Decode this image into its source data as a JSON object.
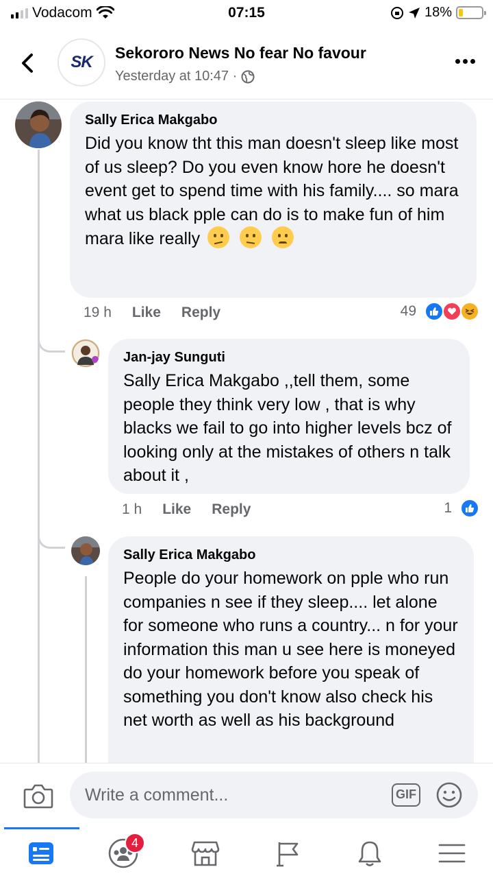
{
  "status_bar": {
    "carrier": "Vodacom",
    "time": "07:15",
    "battery": "18%",
    "battery_level": 0.18
  },
  "header": {
    "page_name": "Sekororo News No fear No favour",
    "logo_text": "SK",
    "timestamp": "Yesterday at 10:47 ·",
    "accent": "#1877f2"
  },
  "comments": [
    {
      "author": "Sally Erica Makgabo",
      "text": "Did you know tht this man doesn't sleep like most of us sleep? Do you even know hore he doesn't event get to spend time with his family.... so mara what us black pple can do is to make fun of him mara like really",
      "emojis": [
        "thinking-face",
        "confused-face",
        "pensive-face"
      ],
      "time": "19 h",
      "like": "Like",
      "reply": "Reply",
      "reaction_count": "49",
      "reactions": [
        "like",
        "love",
        "haha"
      ]
    },
    {
      "author": "Jan-jay Sunguti",
      "text": "Sally Erica Makgabo ,,tell them, some people they think very low , that is why blacks we fail to go into higher levels bcz of looking only at the mistakes of others n talk about it ,",
      "time": "1 h",
      "like": "Like",
      "reply": "Reply",
      "reaction_count": "1",
      "reactions": [
        "like"
      ]
    },
    {
      "author": "Sally Erica Makgabo",
      "text": "People do your homework on pple who run companies n see if they sleep.... let alone for someone who runs a country... n for your information this man u see here is moneyed do your homework before you  speak of something you don't know also check his net worth as well as his background"
    }
  ],
  "composer": {
    "placeholder": "Write a comment...",
    "gif_label": "GIF"
  },
  "tabbar": {
    "items": [
      "news-feed-icon",
      "groups-icon",
      "marketplace-icon",
      "pages-icon",
      "notifications-icon",
      "menu-icon"
    ],
    "groups_badge": "4"
  }
}
